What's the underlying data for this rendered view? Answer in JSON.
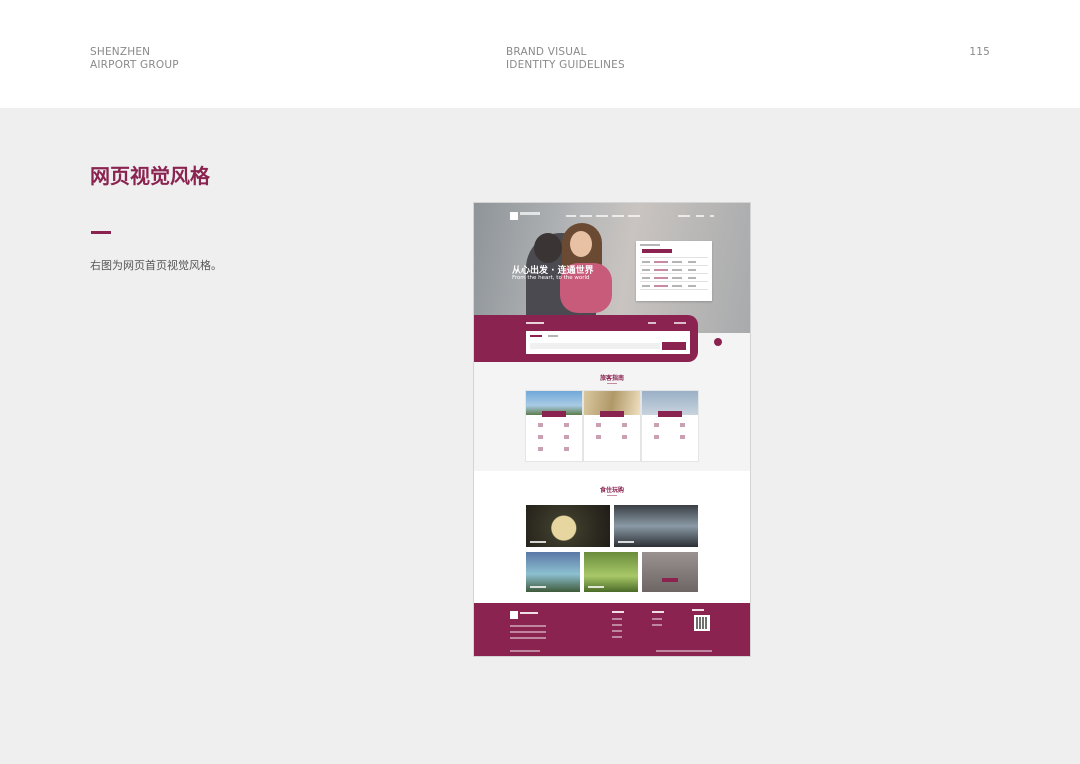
{
  "header": {
    "org_line1": "SHENZHEN",
    "org_line2": "AIRPORT GROUP",
    "doc_line1": "BRAND VISUAL",
    "doc_line2": "IDENTITY GUIDELINES",
    "page_number": "115"
  },
  "section": {
    "title": "网页视觉风格",
    "description": "右图为网页首页视觉风格。"
  },
  "mockup": {
    "hero_title": "从心出发 · 连通世界",
    "hero_subtitle": "From the heart, to the world",
    "guide_heading": "旅客指南",
    "food_heading": "食住玩购",
    "accent_color": "#8a2350"
  }
}
